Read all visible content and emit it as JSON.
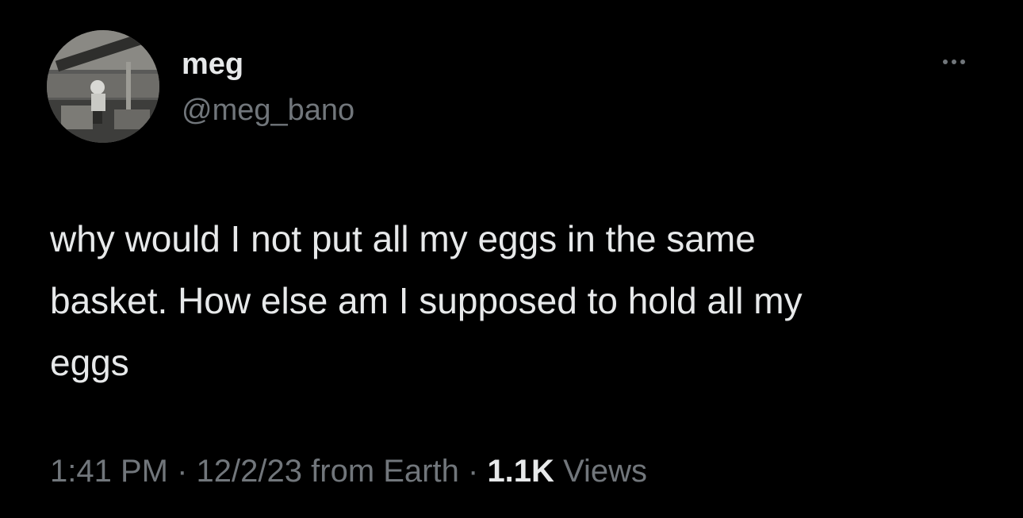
{
  "tweet": {
    "author": {
      "display_name": "meg",
      "handle": "@meg_bano",
      "avatar_icon": "profile-photo"
    },
    "more_icon": "more-horizontal-icon",
    "text": "why would I not put all my eggs in the same\nbasket. How else am I supposed to hold all my\neggs",
    "meta": {
      "time": "1:41 PM",
      "separator": "·",
      "date": "12/2/23",
      "source": "from Earth",
      "views_count": "1.1K",
      "views_label": "Views"
    }
  },
  "colors": {
    "background": "#000000",
    "primary_text": "#e7e9ea",
    "secondary_text": "#71767b"
  }
}
